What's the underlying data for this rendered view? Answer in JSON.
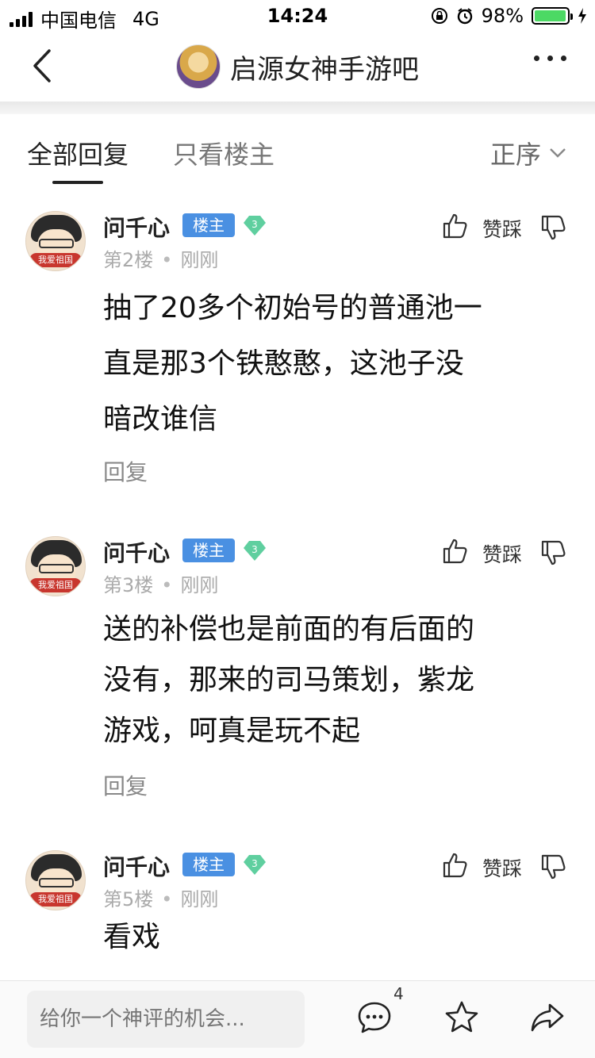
{
  "status": {
    "carrier": "中国电信",
    "network": "4G",
    "time": "14:24",
    "battery": "98%",
    "battery_level": 0.98,
    "battery_color": "#4cd964"
  },
  "nav": {
    "title": "启源女神手游吧"
  },
  "tabs": {
    "all": "全部回复",
    "owner_only": "只看楼主",
    "sort": "正序"
  },
  "posts": [
    {
      "username": "问千心",
      "badge": "楼主",
      "level": "3",
      "floor": "第2楼",
      "time": "刚刚",
      "vote_label": "赞踩",
      "content_lines": [
        "抽了20多个初始号的普通池一",
        "直是那3个铁憨憨，这池子没",
        "暗改谁信"
      ],
      "reply": "回复",
      "avatar_ribbon": "我爱祖国"
    },
    {
      "username": "问千心",
      "badge": "楼主",
      "level": "3",
      "floor": "第3楼",
      "time": "刚刚",
      "vote_label": "赞踩",
      "content_lines": [
        "送的补偿也是前面的有后面的",
        "没有，那来的司马策划，紫龙",
        "游戏，呵真是玩不起"
      ],
      "reply": "回复",
      "avatar_ribbon": "我爱祖国"
    },
    {
      "username": "问千心",
      "badge": "楼主",
      "level": "3",
      "floor": "第5楼",
      "time": "刚刚",
      "vote_label": "赞踩",
      "content_lines": [
        "看戏"
      ],
      "reply": "",
      "avatar_ribbon": "我爱祖国"
    }
  ],
  "bottom": {
    "input_placeholder": "给你一个神评的机会...",
    "comment_count": "4"
  },
  "colors": {
    "owner_badge": "#4a90e2",
    "level_badge": "#5fcf9f"
  }
}
